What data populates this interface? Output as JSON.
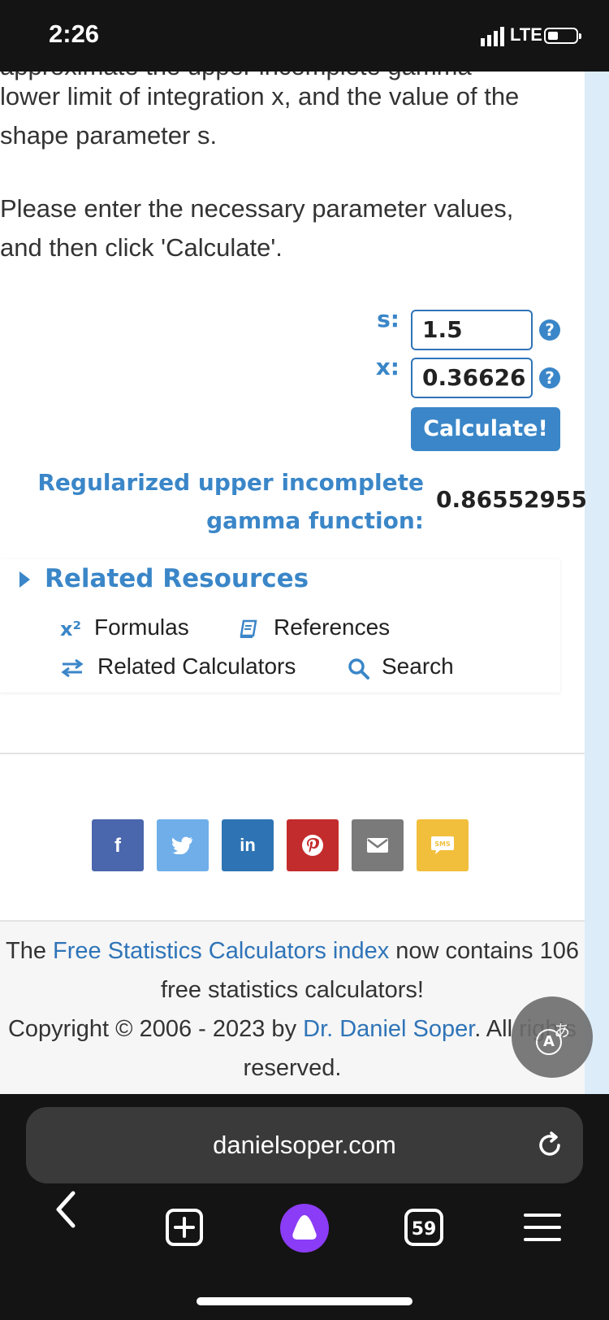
{
  "status_bar": {
    "time": "2:26",
    "network": "LTE"
  },
  "intro": {
    "cut_line": "approximate the upper incomplete gamma",
    "line1": "lower limit of integration x, and the value of the",
    "line2": "shape parameter s.",
    "line3": "Please enter the necessary parameter values,",
    "line4": "and then click 'Calculate'."
  },
  "form": {
    "s_label": "s:",
    "s_value": "1.5",
    "x_label": "x:",
    "x_value": "0.36626",
    "help_glyph": "?",
    "calculate_label": "Calculate!"
  },
  "result": {
    "label_line1": "Regularized upper incomplete",
    "label_line2": "gamma function:",
    "value": "0.86552955"
  },
  "related": {
    "title": "Related Resources",
    "formulas": "Formulas",
    "formulas_icon_text": "x²",
    "references": "References",
    "related_calculators": "Related Calculators",
    "search": "Search"
  },
  "share": {
    "buttons": [
      "facebook",
      "twitter",
      "linkedin",
      "pinterest",
      "email",
      "sms"
    ],
    "facebook_glyph": "f",
    "linkedin_glyph": "in",
    "sms_glyph": "SMS"
  },
  "footer": {
    "the": "The ",
    "index_link": "Free Statistics Calculators index",
    "contains": " now contains 106",
    "free_line": "free statistics calculators!",
    "copyright_pre": "Copyright © 2006 - 2023 by ",
    "author_link": "Dr. Daniel Soper",
    "copyright_post": ". All rights",
    "reserved": "reserved."
  },
  "browser": {
    "url": "danielsoper.com",
    "tab_count": "59"
  },
  "colors": {
    "accent": "#3a86c8",
    "facebook": "#4a66ad",
    "twitter": "#6faee9",
    "linkedin": "#2e74b4",
    "pinterest": "#c32c2c",
    "email": "#7a7a7a",
    "sms": "#f2bf3c",
    "assistant": "#8b3cf6"
  }
}
